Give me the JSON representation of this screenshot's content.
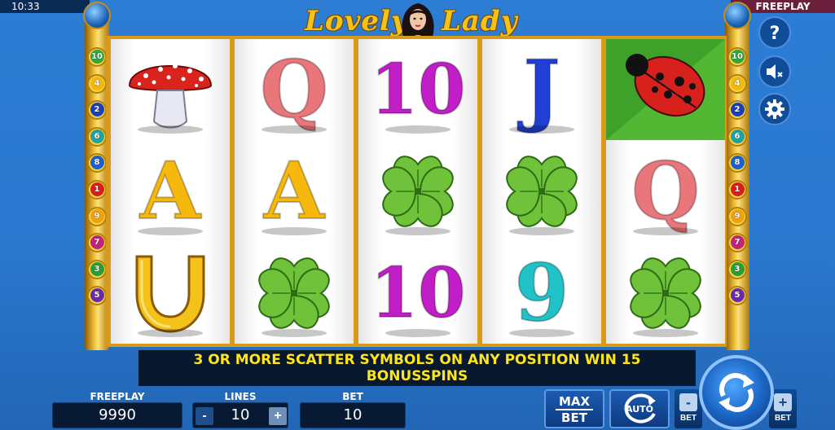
{
  "status_bar": {
    "time": "10:33",
    "mode": "FREEPLAY"
  },
  "logo": {
    "word1": "Lovely",
    "word2": "Lady"
  },
  "paylines_left": [
    "10",
    "4",
    "2",
    "6",
    "8",
    "1",
    "9",
    "7",
    "3",
    "5"
  ],
  "paylines_right": [
    "10",
    "4",
    "2",
    "6",
    "8",
    "1",
    "9",
    "7",
    "3",
    "5"
  ],
  "payline_colors": {
    "10": "#2fa640",
    "4": "#f1b90e",
    "2": "#1d3fb4",
    "6": "#23a0a0",
    "8": "#1d5fd1",
    "1": "#d3201f",
    "9": "#f1a10e",
    "7": "#c1227a",
    "3": "#2c9c34",
    "5": "#6b2aa6"
  },
  "reels": [
    [
      "mushroom",
      "A",
      "horseshoe"
    ],
    [
      "Q",
      "A",
      "clover"
    ],
    [
      "10",
      "clover",
      "10"
    ],
    [
      "J",
      "clover",
      "9"
    ],
    [
      "ladybug",
      "Q",
      "clover"
    ]
  ],
  "symbol_colors": {
    "Q": "#e9767a",
    "A": "#f6b80c",
    "10": "#c21ec8",
    "J": "#1f3fd6",
    "9": "#20c2c8"
  },
  "side_buttons": {
    "help": "help-icon",
    "sound": "sound-muted-icon",
    "settings": "gear-icon"
  },
  "message": {
    "line1": "3 OR MORE SCATTER SYMBOLS ON ANY POSITION WIN 15",
    "line2": "BONUSSPINS"
  },
  "panels": {
    "freeplay_label": "FREEPLAY",
    "freeplay_value": "9990",
    "lines_label": "LINES",
    "lines_value": "10",
    "lines_minus": "-",
    "lines_plus": "+",
    "bet_label": "BET",
    "bet_value": "10"
  },
  "controls": {
    "max_bet_line1": "MAX",
    "max_bet_line2": "BET",
    "auto_label": "AUTO",
    "bet_minus_symbol": "-",
    "bet_minus_label": "BET",
    "bet_plus_symbol": "+",
    "bet_plus_label": "BET"
  }
}
